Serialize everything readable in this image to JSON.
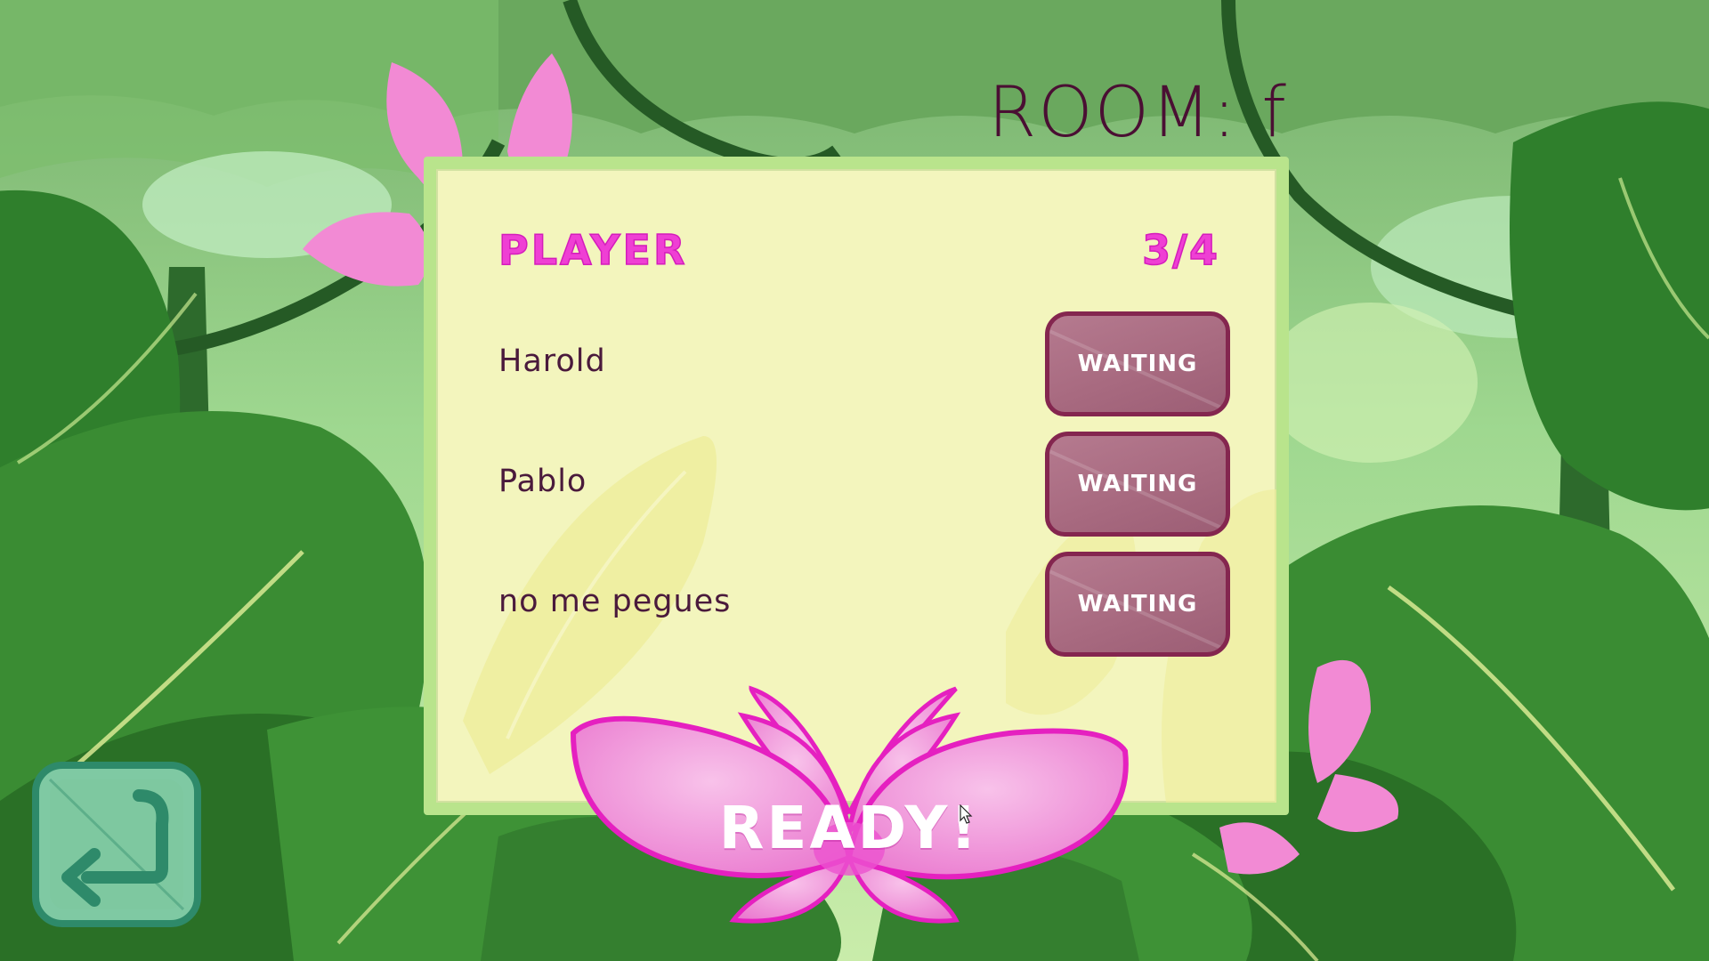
{
  "room": {
    "label": "ROOM: f"
  },
  "lobby": {
    "header_player": "PLAYER",
    "header_count": "3/4",
    "players": [
      {
        "name": "Harold",
        "status": "WAITING"
      },
      {
        "name": "Pablo",
        "status": "WAITING"
      },
      {
        "name": "no me pegues",
        "status": "WAITING"
      }
    ]
  },
  "actions": {
    "ready_label": "READY!",
    "back_icon": "return-arrow-icon"
  },
  "colors": {
    "accent_pink": "#ef3fd4",
    "status_badge": "#a86a80",
    "panel": "#f3f5bd",
    "panel_border": "#b9e48c",
    "room_text": "#4a0f33"
  }
}
